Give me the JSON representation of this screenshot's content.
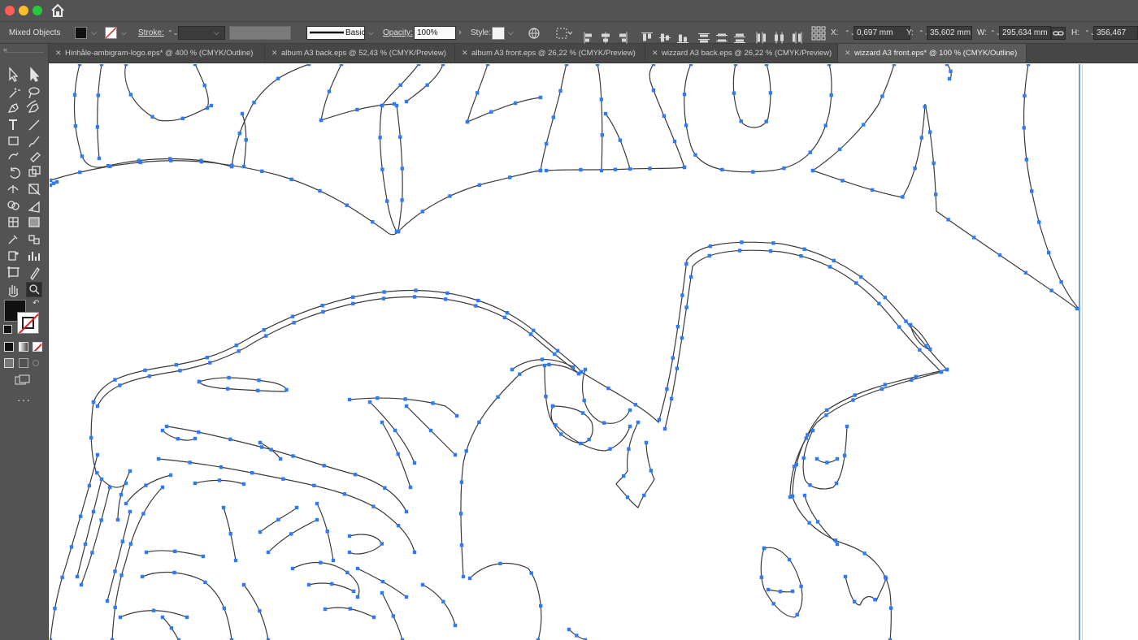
{
  "window": {
    "traffic_lights": [
      "#ff5f57",
      "#febc2e",
      "#28c840"
    ]
  },
  "control_bar": {
    "selection_label": "Mixed Objects",
    "stroke_label": "Stroke:",
    "brush_label": "Basic",
    "opacity_label": "Opacity:",
    "opacity_value": "100%",
    "style_label": "Style:",
    "x_label": "X:",
    "x_value": "0,697 mm",
    "y_label": "Y:",
    "y_value": "35,602 mm",
    "w_label": "W:",
    "w_value": "295,634 mm",
    "h_label": "H:",
    "h_value": "356,467 mm"
  },
  "tabs": [
    {
      "label": "Hinhåle-ambigram-logo.eps* @ 400 % (CMYK/Outline)",
      "active": false
    },
    {
      "label": "album A3 back.eps @ 52,43 % (CMYK/Preview)",
      "active": false
    },
    {
      "label": "album A3 front.eps @ 26,22 % (CMYK/Preview)",
      "active": false
    },
    {
      "label": "wizzard A3 back.eps @ 26,22 % (CMYK/Preview)",
      "active": false
    },
    {
      "label": "wizzard A3 front.eps* @ 100 % (CMYK/Outline)",
      "active": true
    }
  ],
  "tools": [
    "selection-tool",
    "direct-selection-tool",
    "magic-wand-tool",
    "lasso-tool",
    "pen-tool",
    "curvature-tool",
    "type-tool",
    "line-segment-tool",
    "rectangle-tool",
    "paintbrush-tool",
    "shaper-tool",
    "eraser-tool",
    "rotate-tool",
    "scale-tool",
    "width-tool",
    "free-transform-tool",
    "shape-builder-tool",
    "perspective-grid-tool",
    "mesh-tool",
    "gradient-tool",
    "eyedropper-tool",
    "blend-tool",
    "symbol-sprayer-tool",
    "column-graph-tool",
    "artboard-tool",
    "slice-tool",
    "hand-tool",
    "zoom-tool"
  ],
  "colors": {
    "app_chrome": "#535353",
    "anchor_point": "#2f7bf5",
    "path_outline": "#3a3a3a",
    "guide": "#6f9fd8"
  }
}
